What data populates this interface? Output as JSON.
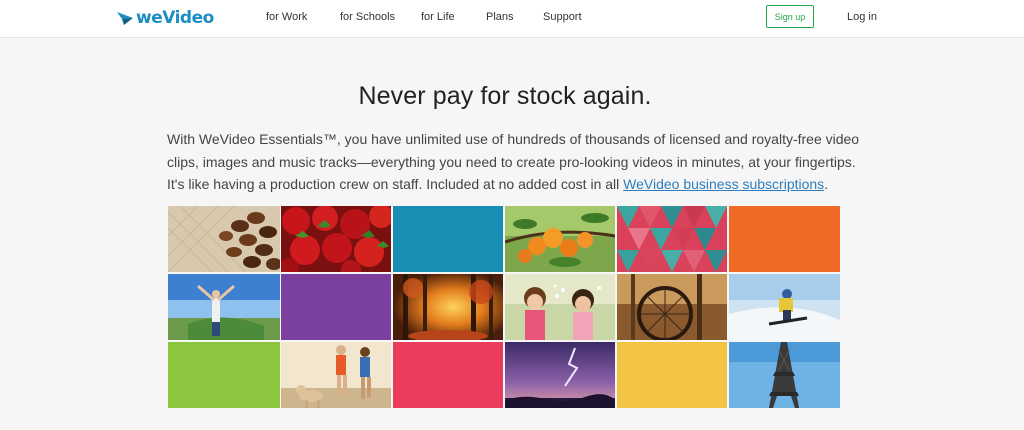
{
  "brand": {
    "logo_text": "weVideo",
    "logo_color": "#1c8ec4"
  },
  "nav": {
    "items": [
      {
        "label": "for Work"
      },
      {
        "label": "for Schools"
      },
      {
        "label": "for Life"
      },
      {
        "label": "Plans"
      },
      {
        "label": "Support"
      }
    ],
    "signup_label": "Sign up",
    "login_label": "Log in"
  },
  "hero": {
    "headline": "Never pay for stock again.",
    "lines": [
      "With WeVideo Essentials™, you have unlimited use of hundreds of thousands of licensed and royalty-free video",
      "clips, images and music tracks—everything you need to create pro-looking videos in minutes, at your fingertips.",
      "It's like having a production crew on staff. Included at no added cost in all "
    ],
    "link_text": "WeVideo business subscriptions",
    "link_suffix": "."
  },
  "gallery": {
    "tiles": [
      {
        "name": "coffee-beans-image"
      },
      {
        "name": "strawberries-image"
      },
      {
        "name": "blue-tile",
        "color": "#1a8fb5"
      },
      {
        "name": "apricots-image"
      },
      {
        "name": "geometric-pattern-image"
      },
      {
        "name": "orange-tile",
        "color": "#ee6a25"
      },
      {
        "name": "man-arms-raised-image"
      },
      {
        "name": "purple-tile",
        "color": "#7b3fa0"
      },
      {
        "name": "autumn-forest-image"
      },
      {
        "name": "girls-blowing-image"
      },
      {
        "name": "bicycle-wheel-image"
      },
      {
        "name": "snowboarder-image"
      },
      {
        "name": "green-tile",
        "color": "#8cc63f"
      },
      {
        "name": "runners-with-dog-image"
      },
      {
        "name": "pink-tile",
        "color": "#ec3c5e"
      },
      {
        "name": "lightning-sky-image"
      },
      {
        "name": "yellow-tile",
        "color": "#f2c443"
      },
      {
        "name": "eiffel-tower-image"
      }
    ]
  },
  "colors": {
    "accent_green": "#26a84b",
    "link_blue": "#2f7dbd",
    "background": "#f6f6f6"
  }
}
